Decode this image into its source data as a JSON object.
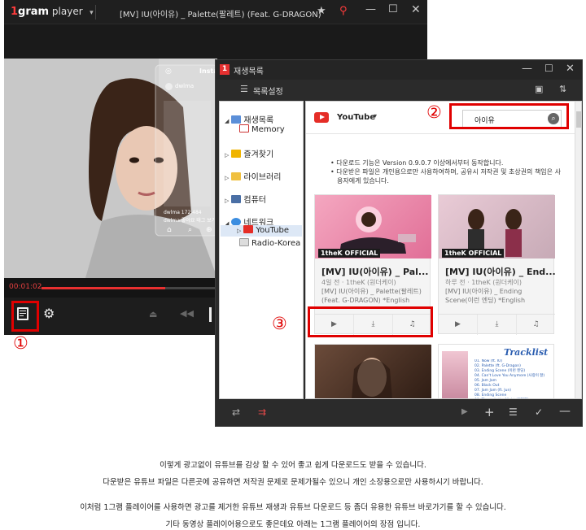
{
  "player": {
    "logo_prefix": "1",
    "logo_main": "gram",
    "logo_suffix": " player",
    "title": "[MV] IU(아이유) _ Palette(팔레트) (Feat. G-DRAGON)",
    "time": "00:01:02",
    "progress_percent": 32
  },
  "video_overlay": {
    "tab": "Insta",
    "username": "dwlma",
    "caption": "dwlma 172,484",
    "subcaption": "dwlma 좋아요 태그 보기"
  },
  "playlist_window": {
    "title": "재생목록",
    "settings_label": "목록설정",
    "tree": {
      "playlist": "재생목록",
      "memory": "Memory",
      "favorites": "즐겨찾기",
      "library": "라이브러리",
      "computer": "컴퓨터",
      "network": "네트워크",
      "youtube": "YouTube",
      "radio": "Radio-Korea"
    },
    "youtube_label": "YouTube",
    "search_value": "아이유",
    "notice": [
      "다운로드 기능은 Version 0.9.0.7 이상에서부터 동작합니다.",
      "다운받은 파일은 개인용으로만 사용하여하며, 공유시 저작권 및 초상권의 책임은 사용자에게 있습니다."
    ],
    "cards": [
      {
        "title": "[MV] IU(아이유) _ Pal...",
        "meta": "4일 전 · 1theK (원더케이)",
        "desc": "[MV] IU(아이유) _ Palette(팔레트) (Feat. G-DRAGON) *English",
        "badge": "OFFICIAL",
        "badge_prefix": "1theK"
      },
      {
        "title": "[MV] IU(아이유) _ End...",
        "meta": "하루 전 · 1theK (원더케이)",
        "desc": "[MV] IU(아이유) _ Ending Scene(이런 엔딩) *English",
        "badge": "OFFICIAL",
        "badge_prefix": "1theK"
      }
    ],
    "tracklist_label": "Tracklist",
    "tracklist": [
      "01. Now (ft. IU)",
      "02. Palette (ft. G-Dragon)",
      "03. Ending Scene (이런 엔딩)",
      "04. Can't Love You Anymore (사랑이 잘)",
      "05. Jam Jam",
      "06. Black Out",
      "07. Jam Jam (ft. Jun)",
      "08. Ending Scene",
      "09. Through the Night (밤편지)"
    ]
  },
  "annotations": [
    "①",
    "②",
    "③"
  ],
  "captions": [
    "이렇게 광고없이 유튜브를 감상 할 수 있어 좋고 쉽게 다운로드도 받을 수 있습니다.",
    "다운받은 유튜브 파일은 다른곳에 공유하면 저작권 문제로 문제가될수 있으니 개인 소장용으로만 사용하시기 바랍니다.",
    "이처럼 1그램 플레이어를 사용하면 광고를 제거한 유튜브 재생과 유튜브 다운로드 등 좀더 유용한 유튜브 바로가기를 할 수 있습니다.",
    "기타 동영상 플레이어용으로도 좋은데요 아래는 1그램 플레이어의 장점 입니다."
  ]
}
